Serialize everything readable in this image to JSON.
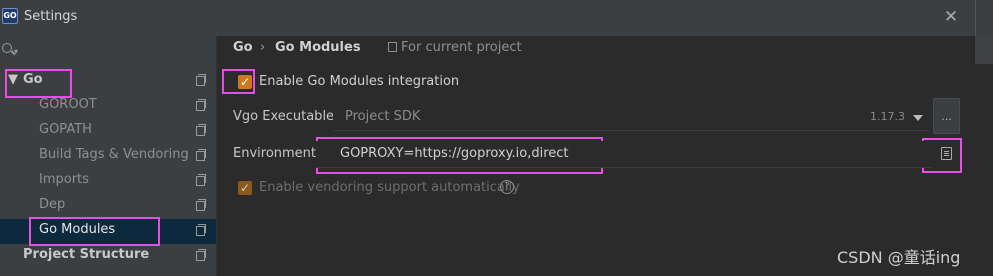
{
  "window": {
    "app_icon_text": "GO",
    "title": "Settings",
    "close_glyph": "✕"
  },
  "sidebar": {
    "search_icon": "search-icon",
    "items": [
      {
        "label": "Go",
        "level": 0,
        "expanded": true,
        "arrow": "▼"
      },
      {
        "label": "GOROOT",
        "level": 1
      },
      {
        "label": "GOPATH",
        "level": 1
      },
      {
        "label": "Build Tags & Vendoring",
        "level": 1
      },
      {
        "label": "Imports",
        "level": 1
      },
      {
        "label": "Dep",
        "level": 1
      },
      {
        "label": "Go Modules",
        "level": 1,
        "selected": true
      },
      {
        "label": "Project Structure",
        "level": 0
      }
    ]
  },
  "breadcrumb": {
    "parent": "Go",
    "separator": "›",
    "current": "Go Modules",
    "scope": "For current project"
  },
  "settings": {
    "enable_modules": {
      "label": "Enable Go Modules integration",
      "checked": true
    },
    "vgo": {
      "label": "Vgo Executable:",
      "value": "Project SDK",
      "version": "1.17.3",
      "browse_label": "..."
    },
    "environment": {
      "label": "Environment:",
      "value": "GOPROXY=https://goproxy.io,direct"
    },
    "vendoring": {
      "label": "Enable vendoring support automatically",
      "checked": true,
      "enabled": false,
      "help_glyph": "?"
    }
  },
  "watermark": "CSDN @童话ing",
  "colors": {
    "highlight": "#e64ee6",
    "checkbox": "#cc7a1d",
    "selection": "#0d293e",
    "panel": "#3c3f41",
    "content": "#2b2b2b"
  }
}
